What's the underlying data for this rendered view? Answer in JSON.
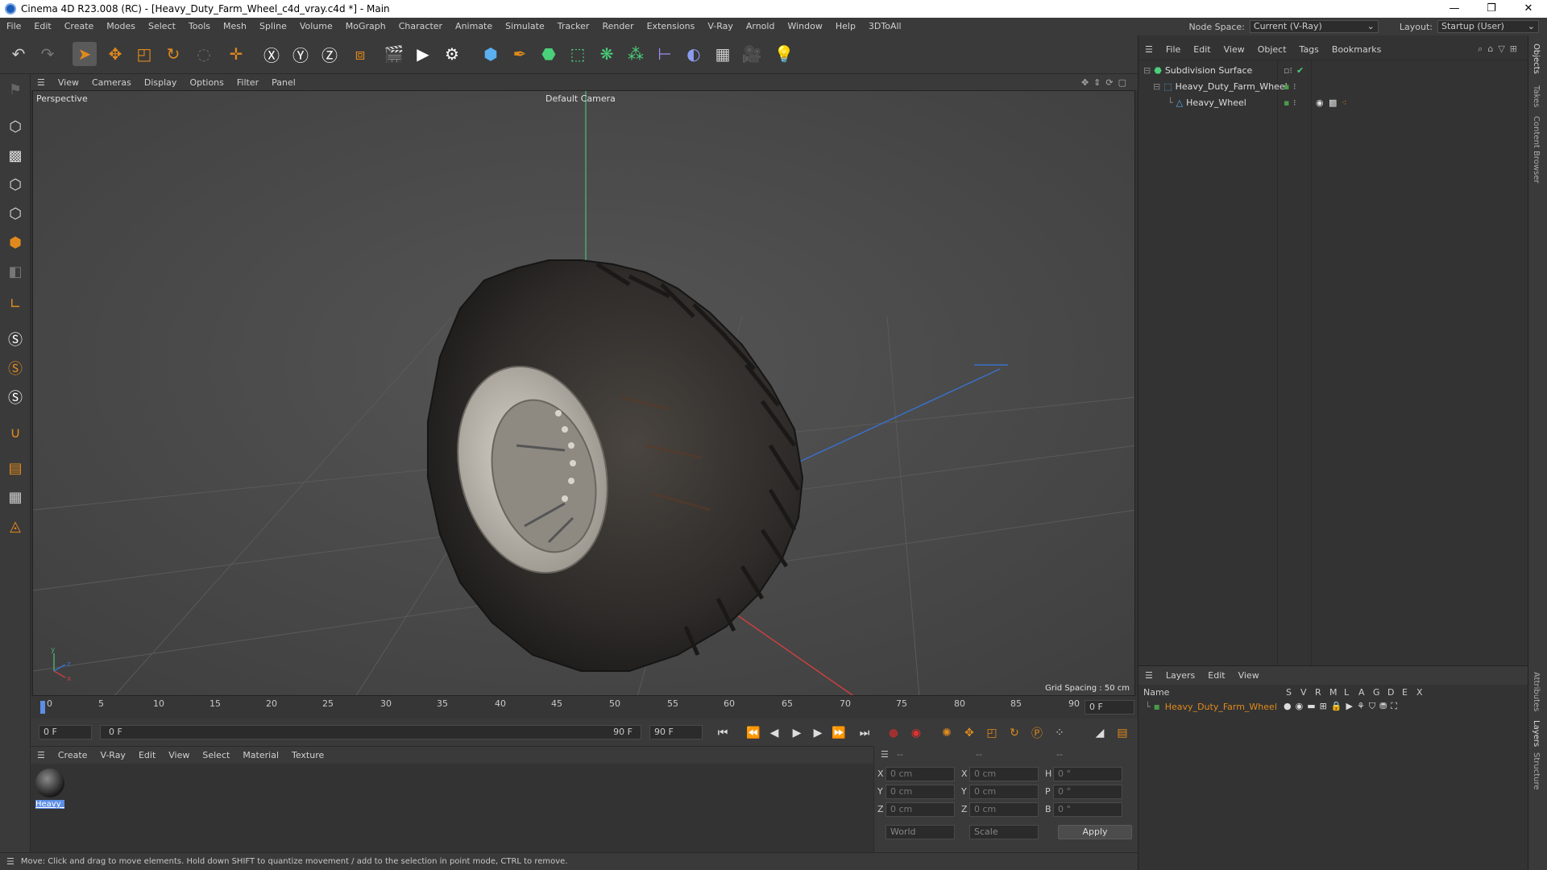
{
  "window": {
    "title": "Cinema 4D R23.008 (RC) - [Heavy_Duty_Farm_Wheel_c4d_vray.c4d *] - Main",
    "minimize": "—",
    "maximize": "❐",
    "close": "✕"
  },
  "menubar": {
    "items": [
      "File",
      "Edit",
      "Create",
      "Modes",
      "Select",
      "Tools",
      "Mesh",
      "Spline",
      "Volume",
      "MoGraph",
      "Character",
      "Animate",
      "Simulate",
      "Tracker",
      "Render",
      "Extensions",
      "V-Ray",
      "Arnold",
      "Window",
      "Help",
      "3DToAll"
    ],
    "node_space_label": "Node Space:",
    "node_space_value": "Current (V-Ray)",
    "layout_label": "Layout:",
    "layout_value": "Startup (User)"
  },
  "viewport": {
    "menu": [
      "View",
      "Cameras",
      "Display",
      "Options",
      "Filter",
      "Panel"
    ],
    "view_name": "Perspective",
    "camera": "Default Camera",
    "grid_spacing": "Grid Spacing : 50 cm"
  },
  "timeline": {
    "ticks": [
      "0",
      "5",
      "10",
      "15",
      "20",
      "25",
      "30",
      "35",
      "40",
      "45",
      "50",
      "55",
      "60",
      "65",
      "70",
      "75",
      "80",
      "85",
      "90"
    ],
    "current_frame_right": "0 F"
  },
  "playback": {
    "start_field": "0 F",
    "range_start": "0 F",
    "range_end": "90 F",
    "end_field": "90 F"
  },
  "material_manager": {
    "menu": [
      "Create",
      "V-Ray",
      "Edit",
      "View",
      "Select",
      "Material",
      "Texture"
    ],
    "material_name": "Heavy_W"
  },
  "coordinates": {
    "headers": [
      "--",
      "--",
      "--"
    ],
    "rows": [
      {
        "axis": "X",
        "pos": "0 cm",
        "size_axis": "X",
        "size": "0 cm",
        "rot_axis": "H",
        "rot": "0 °"
      },
      {
        "axis": "Y",
        "pos": "0 cm",
        "size_axis": "Y",
        "size": "0 cm",
        "rot_axis": "P",
        "rot": "0 °"
      },
      {
        "axis": "Z",
        "pos": "0 cm",
        "size_axis": "Z",
        "size": "0 cm",
        "rot_axis": "B",
        "rot": "0 °"
      }
    ],
    "space": "World",
    "mode": "Scale",
    "apply": "Apply"
  },
  "status": "Move: Click and drag to move elements. Hold down SHIFT to quantize movement / add to the selection in point mode, CTRL to remove.",
  "object_manager": {
    "menu": [
      "File",
      "Edit",
      "View",
      "Object",
      "Tags",
      "Bookmarks"
    ],
    "objects": [
      {
        "name": "Subdivision Surface",
        "indent": 0
      },
      {
        "name": "Heavy_Duty_Farm_Wheel",
        "indent": 1
      },
      {
        "name": "Heavy_Wheel",
        "indent": 2
      }
    ]
  },
  "layer_manager": {
    "menu": [
      "Layers",
      "Edit",
      "View"
    ],
    "name_header": "Name",
    "flag_headers": [
      "S",
      "V",
      "R",
      "M",
      "L",
      "A",
      "G",
      "D",
      "E",
      "X"
    ],
    "layers": [
      {
        "name": "Heavy_Duty_Farm_Wheel",
        "color": "#4a9a4a"
      }
    ]
  },
  "side_tabs": [
    "Objects",
    "Takes",
    "Content Browser",
    "Attributes",
    "Layers",
    "Structure"
  ],
  "colors": {
    "accent_orange": "#e08a1e",
    "selection_blue": "#5b8ee6",
    "layer_text": "#e08a1e"
  }
}
